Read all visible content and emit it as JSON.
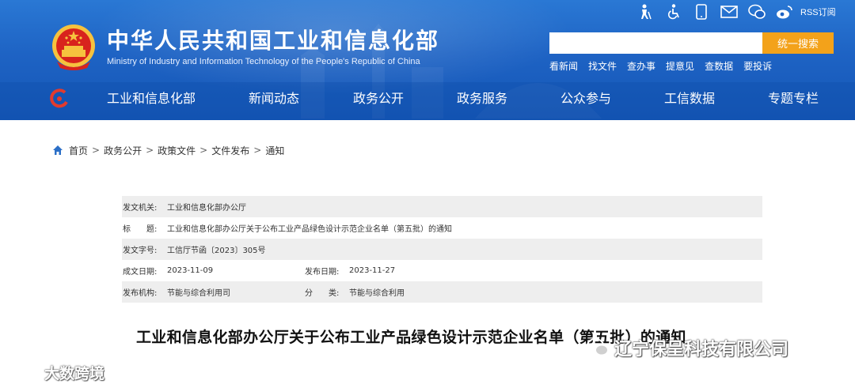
{
  "header": {
    "site_title": "中华人民共和国工业和信息化部",
    "site_subtitle": "Ministry of Industry and Information Technology of the People's Republic of China",
    "rss_label": "RSS订阅",
    "search": {
      "placeholder": "",
      "button_label": "统一搜索"
    },
    "quick_links": [
      "看新闻",
      "找文件",
      "查办事",
      "提意见",
      "查数据",
      "要投诉"
    ],
    "nav": [
      "工业和信息化部",
      "新闻动态",
      "政务公开",
      "政务服务",
      "公众参与",
      "工信数据",
      "专题专栏"
    ],
    "accent_color": "#f3a21a",
    "bg_color": "#1e63c4"
  },
  "breadcrumb": [
    "首页",
    "政务公开",
    "政策文件",
    "文件发布",
    "通知"
  ],
  "meta": {
    "issuer_label": "发文机关:",
    "issuer": "工业和信息化部办公厅",
    "title_label": "标　　题:",
    "title": "工业和信息化部办公厅关于公布工业产品绿色设计示范企业名单（第五批）的通知",
    "doc_no_label": "发文字号:",
    "doc_no": "工信厅节函〔2023〕305号",
    "created_label": "成文日期:",
    "created": "2023-11-09",
    "published_label": "发布日期:",
    "published": "2023-11-27",
    "org_label": "发布机构:",
    "org": "节能与综合利用司",
    "category_label": "分　　类:",
    "category": "节能与综合利用"
  },
  "article_title": "工业和信息化部办公厅关于公布工业产品绿色设计示范企业名单（第五批）的通知",
  "watermarks": {
    "left": "大数跨境",
    "right": "辽宁保呈科技有限公司"
  }
}
